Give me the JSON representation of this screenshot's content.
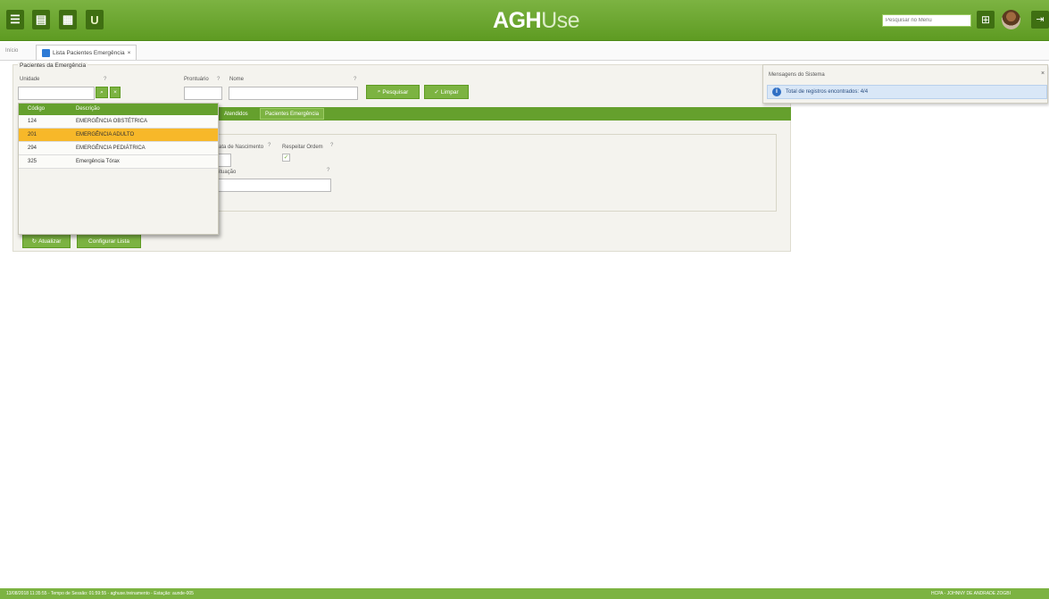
{
  "app": {
    "brand_a": "AGH",
    "brand_b": "Use",
    "search_placeholder": "Pesquisar no Menu"
  },
  "tabs": {
    "home": "Início",
    "active": "Lista Pacientes Emergência",
    "close": "×"
  },
  "form": {
    "fieldset_title": "Pacientes da Emergência",
    "unidade_label": "Unidade",
    "prontuario_label": "Prontuário",
    "nome_label": "Nome",
    "help": "?",
    "pesquisar": "Pesquisar",
    "limpar": "Limpar",
    "nascimento_label": "ata de Nascimento",
    "respeitar_label": "Respeitar Ordem",
    "situacao_label": "ituação",
    "atualizar": "Atualizar",
    "configurar": "Configurar Lista"
  },
  "bottom_tabs": [
    "Atendidos",
    "Pacientes Emergência"
  ],
  "dropdown": {
    "headers": [
      "Código",
      "Descrição"
    ],
    "rows": [
      {
        "code": "124",
        "desc": "EMERGÊNCIA OBSTÉTRICA"
      },
      {
        "code": "201",
        "desc": "EMERGÊNCIA ADULTO"
      },
      {
        "code": "294",
        "desc": "EMERGÊNCIA PEDIÁTRICA"
      },
      {
        "code": "325",
        "desc": "Emergência Tórax"
      }
    ],
    "selected_index": 1
  },
  "messages": {
    "title": "Mensagens do Sistema",
    "close": "×",
    "text": "Total de registros encontrados: 4/4"
  },
  "status": {
    "left": "13/08/2018 11:35:55 - Tempo de Sessão: 01:59:55 - aghuse.treinamento - Estação: aunde-005",
    "right": "HCPA - JOHNNY DE ANDRADE ZOGBI"
  }
}
